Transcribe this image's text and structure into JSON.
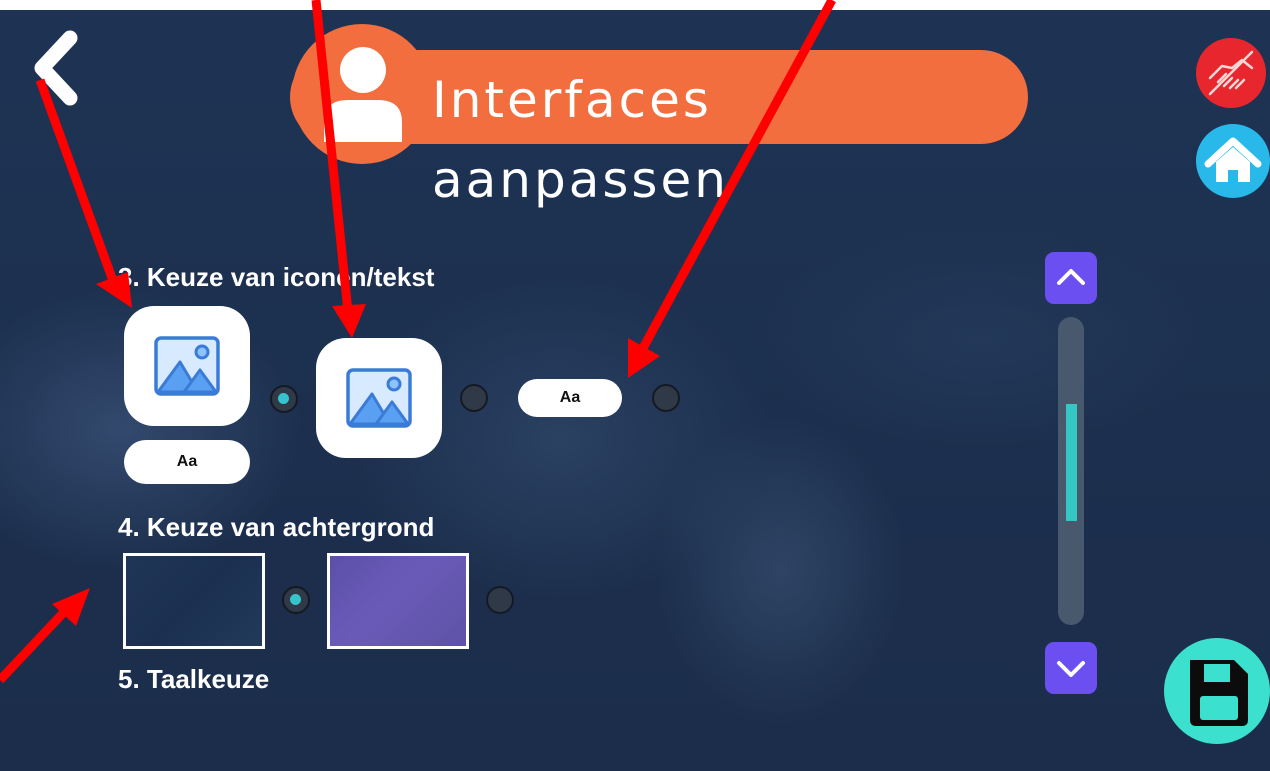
{
  "header": {
    "title": "Interfaces aanpassen",
    "back_icon": "chevron-left-icon",
    "avatar_icon": "user-icon",
    "accent_color": "#f26e3e"
  },
  "side_buttons": {
    "help_icon": "handshake-icon",
    "home_icon": "home-icon",
    "save_icon": "floppy-disk-icon"
  },
  "sections": {
    "icons_text": {
      "title": "3. Keuze van iconen/tekst",
      "options": [
        {
          "type": "icon-with-text",
          "text_label": "Aa",
          "selected": true
        },
        {
          "type": "icon-only",
          "selected": false
        },
        {
          "type": "text-only",
          "text_label": "Aa",
          "selected": false
        }
      ]
    },
    "background": {
      "title": "4. Keuze van achtergrond",
      "options": [
        {
          "color": "#1e3354",
          "selected": true
        },
        {
          "color": "#6a5bb8",
          "selected": false
        }
      ]
    },
    "language": {
      "title": "5. Taalkeuze"
    }
  },
  "scroll": {
    "up_icon": "chevron-up-icon",
    "down_icon": "chevron-down-icon",
    "position_fraction": 0.34
  },
  "colors": {
    "background": "#1c2f4e",
    "radio_selected": "#36c4cc",
    "scroll_buttons": "#6c4ff0",
    "help_button": "#e8262d",
    "home_button": "#29b8ea",
    "save_button": "#3ce0cf",
    "annotation_arrows": "#ff0000"
  }
}
